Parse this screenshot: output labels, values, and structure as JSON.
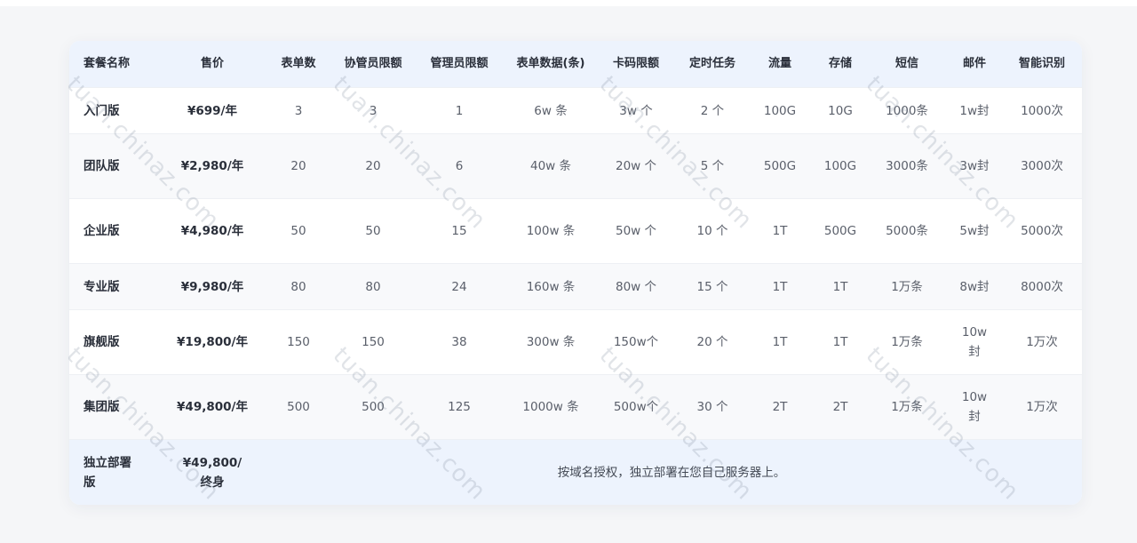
{
  "table": {
    "headers": [
      "套餐名称",
      "售价",
      "表单数",
      "协管员限额",
      "管理员限额",
      "表单数据(条)",
      "卡码限额",
      "定时任务",
      "流量",
      "存储",
      "短信",
      "邮件",
      "智能识别"
    ],
    "rows": [
      [
        "入门版",
        "¥699/年",
        "3",
        "3",
        "1",
        "6w 条",
        "3w 个",
        "2 个",
        "100G",
        "10G",
        "1000条",
        "1w封",
        "1000次"
      ],
      [
        "团队版",
        "¥2,980/年",
        "20",
        "20",
        "6",
        "40w 条",
        "20w 个",
        "5 个",
        "500G",
        "100G",
        "3000条",
        "3w封",
        "3000次"
      ],
      [
        "企业版",
        "¥4,980/年",
        "50",
        "50",
        "15",
        "100w 条",
        "50w 个",
        "10 个",
        "1T",
        "500G",
        "5000条",
        "5w封",
        "5000次"
      ],
      [
        "专业版",
        "¥9,980/年",
        "80",
        "80",
        "24",
        "160w 条",
        "80w 个",
        "15 个",
        "1T",
        "1T",
        "1万条",
        "8w封",
        "8000次"
      ],
      [
        "旗舰版",
        "¥19,800/年",
        "150",
        "150",
        "38",
        "300w 条",
        "150w个",
        "20 个",
        "1T",
        "1T",
        "1万条",
        "10w封",
        "1万次"
      ],
      [
        "集团版",
        "¥49,800/年",
        "500",
        "500",
        "125",
        "1000w 条",
        "500w个",
        "30 个",
        "2T",
        "2T",
        "1万条",
        "10w封",
        "1万次"
      ]
    ],
    "deploy": {
      "name": "独立部署版",
      "price": "¥49,800/终身",
      "note": "按域名授权，独立部署在您自己服务器上。"
    }
  },
  "watermark": "tuan.chinaz.com"
}
